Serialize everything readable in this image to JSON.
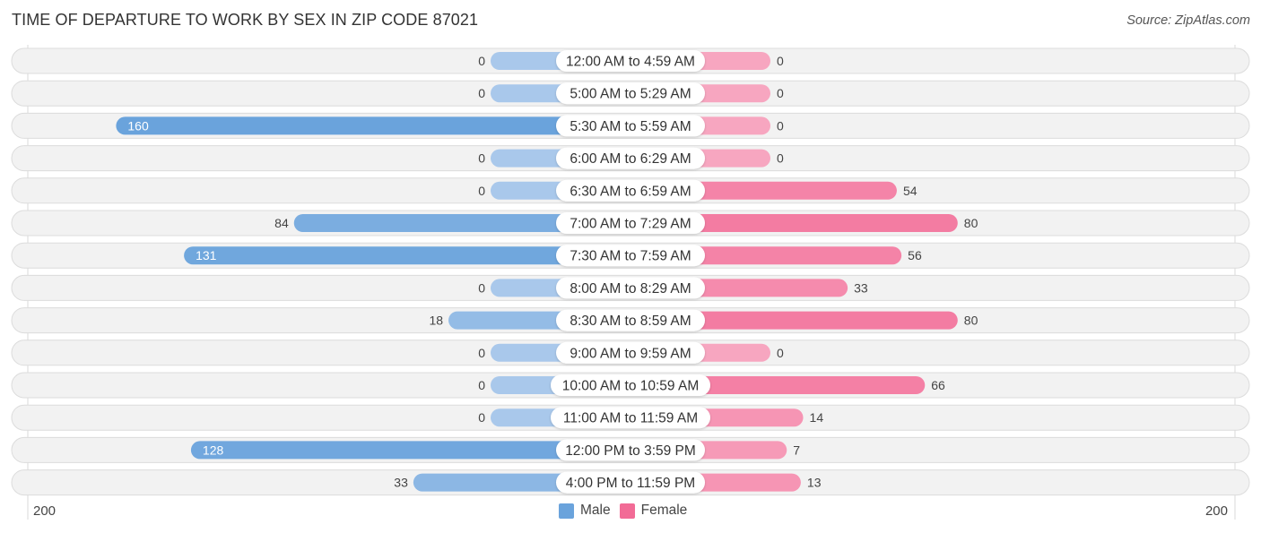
{
  "header": {
    "title": "TIME OF DEPARTURE TO WORK BY SEX IN ZIP CODE 87021",
    "source": "Source: ZipAtlas.com"
  },
  "colors": {
    "male_strong": "#6aa3dc",
    "male_light": "#a9c8eb",
    "female_strong": "#f26b96",
    "female_light": "#f7a6c0",
    "row_bg": "#f2f2f2"
  },
  "chart_data": {
    "type": "bar",
    "orientation": "horizontal-diverging",
    "title": "TIME OF DEPARTURE TO WORK BY SEX IN ZIP CODE 87021",
    "categories": [
      "12:00 AM to 4:59 AM",
      "5:00 AM to 5:29 AM",
      "5:30 AM to 5:59 AM",
      "6:00 AM to 6:29 AM",
      "6:30 AM to 6:59 AM",
      "7:00 AM to 7:29 AM",
      "7:30 AM to 7:59 AM",
      "8:00 AM to 8:29 AM",
      "8:30 AM to 8:59 AM",
      "9:00 AM to 9:59 AM",
      "10:00 AM to 10:59 AM",
      "11:00 AM to 11:59 AM",
      "12:00 PM to 3:59 PM",
      "4:00 PM to 11:59 PM"
    ],
    "series": [
      {
        "name": "Male",
        "values": [
          0,
          0,
          160,
          0,
          0,
          84,
          131,
          0,
          18,
          0,
          0,
          0,
          128,
          33
        ]
      },
      {
        "name": "Female",
        "values": [
          0,
          0,
          0,
          0,
          54,
          80,
          56,
          33,
          80,
          0,
          66,
          14,
          7,
          13
        ]
      }
    ],
    "xlim": [
      200,
      200
    ],
    "axis_left_label": "200",
    "axis_right_label": "200",
    "legend": [
      "Male",
      "Female"
    ],
    "legend_position": "bottom-center",
    "grid": false
  }
}
